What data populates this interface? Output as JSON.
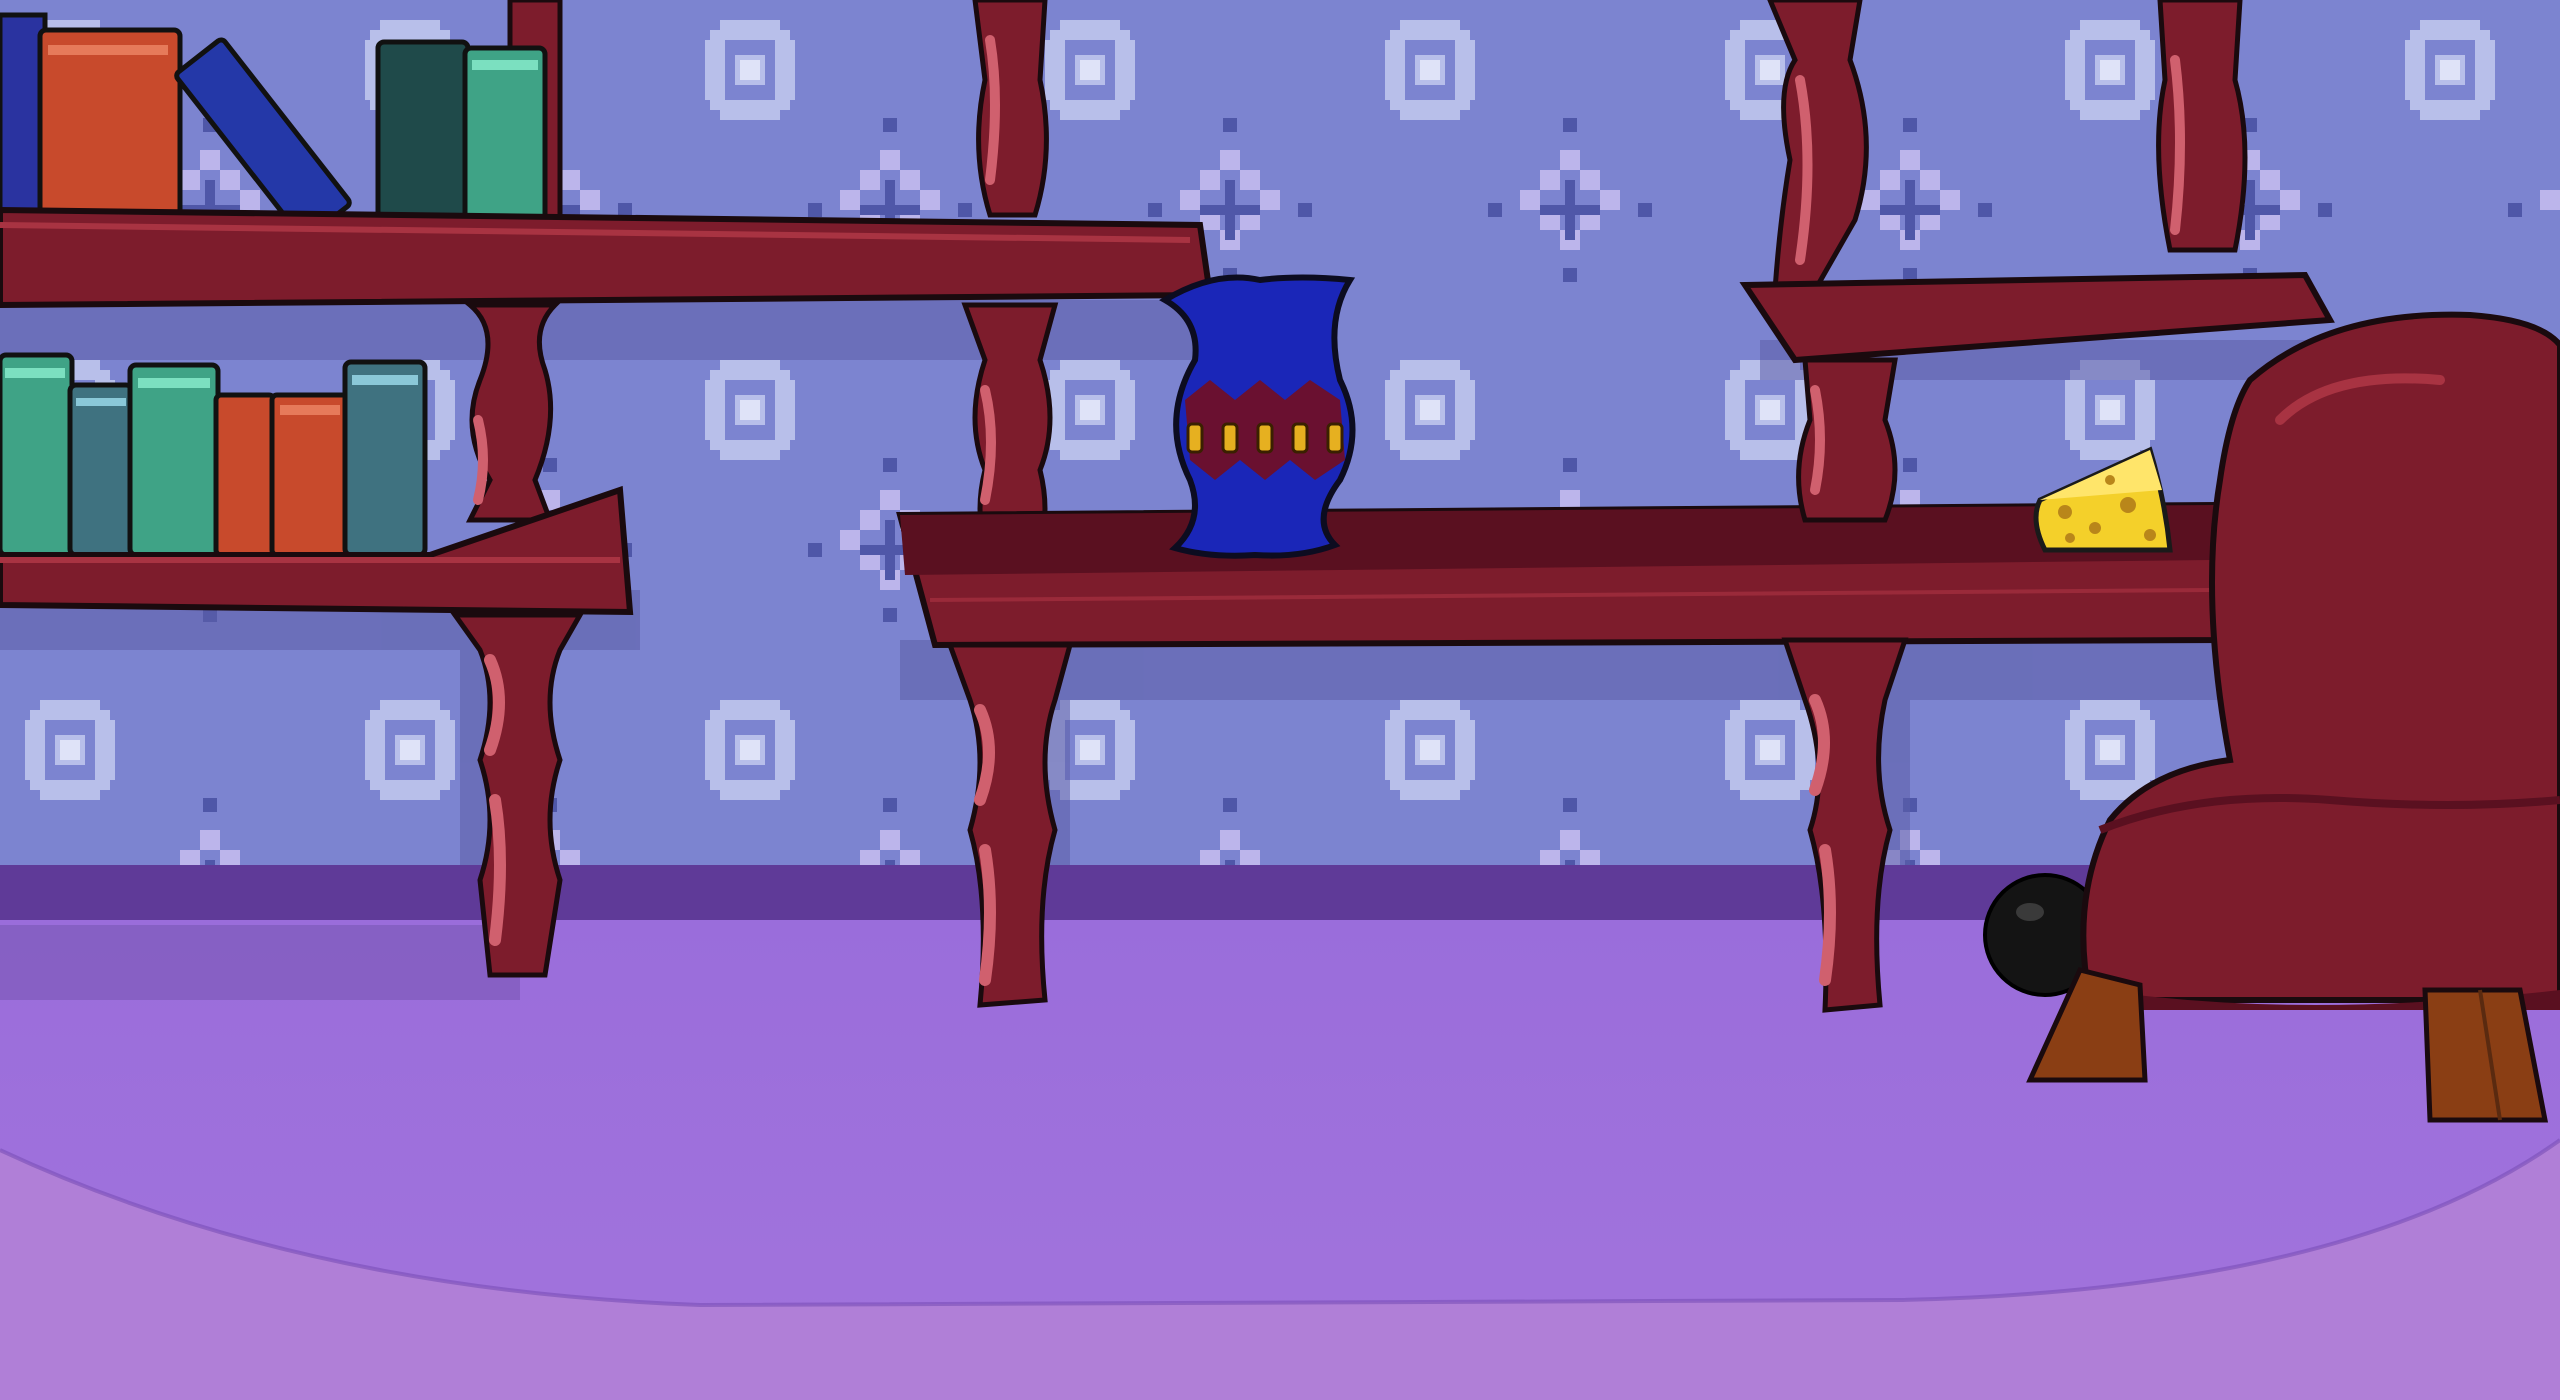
{
  "scene": {
    "title": "",
    "room": "living-room",
    "palette": {
      "wall": "#7c84d0",
      "wall_pattern_light": "#c7cdf0",
      "wall_pattern_dark": "#4f57a8",
      "floor": "#9b70dc",
      "floor_trim": "#6a3f9a",
      "floor_front": "#b47fd8",
      "shelf_wood": "#7d1c2c",
      "shelf_wood_dark": "#5a1020",
      "shelf_highlight": "#d0606e",
      "vase_blue": "#1a26b8",
      "vase_band": "#6a1030",
      "vase_dots": "#e6b020",
      "cheese": "#f4d02a",
      "armchair": "#7d1c2c",
      "chair_legs": "#8a3e14",
      "cannonball": "#141414"
    },
    "objects": [
      {
        "id": "bookshelf-left",
        "icon": "bookshelf-icon",
        "interactable": false
      },
      {
        "id": "shelf-middle",
        "icon": "shelf-icon",
        "interactable": false
      },
      {
        "id": "blue-vase",
        "icon": "vase-icon",
        "interactable": true
      },
      {
        "id": "cheese-wedge",
        "icon": "cheese-icon",
        "interactable": true
      },
      {
        "id": "armchair",
        "icon": "armchair-icon",
        "interactable": true
      },
      {
        "id": "cannonball",
        "icon": "ball-icon",
        "interactable": true
      }
    ],
    "books_top_row": [
      {
        "color": "#2a33a0"
      },
      {
        "color": "#c84a2c"
      },
      {
        "color": "#2438a8",
        "tilted": true
      },
      {
        "color": "#1f4a4a"
      },
      {
        "color": "#3fa386"
      }
    ],
    "books_lower_row": [
      {
        "color": "#3fa386"
      },
      {
        "color": "#3f7280"
      },
      {
        "color": "#3fa386"
      },
      {
        "color": "#c84a2c"
      },
      {
        "color": "#c84a2c"
      },
      {
        "color": "#3f7280"
      }
    ]
  }
}
